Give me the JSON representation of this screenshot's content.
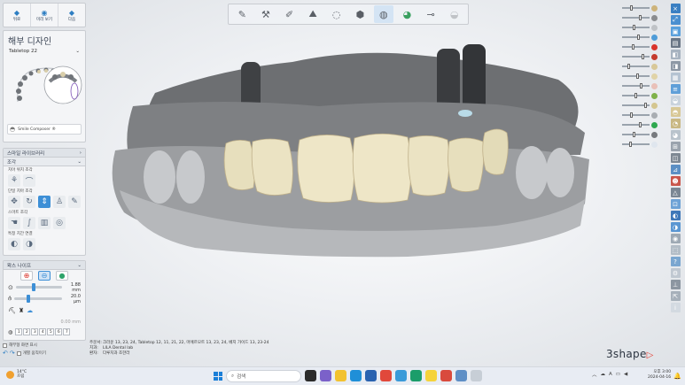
{
  "nav": {
    "back": "뒤로",
    "preview": "미리 보기",
    "next": "다음"
  },
  "design": {
    "title": "해부 디자인",
    "preset": "Tabletop 22"
  },
  "smile_composer": {
    "label": "Smile Composer ®"
  },
  "library": {
    "title": "스마일 라이브러리",
    "section": "조각",
    "sub1": "치아 위치 조각",
    "sub2": "단일 치아 조각",
    "sub3": "스마트 조각",
    "sub4": "특정 치간 연결"
  },
  "wax": {
    "title": "왁스 나이프",
    "size_value": "1.88 mm",
    "strength_value": "20.0 μm",
    "offset_value": "0.00 mm",
    "numbers": [
      "1",
      "2",
      "3",
      "4",
      "5",
      "6",
      "7"
    ],
    "size_fill": 0.35,
    "strength_fill": 0.25
  },
  "options": {
    "anatomy": "해부형 화면 표시",
    "separate": "개별 움직이기"
  },
  "info": {
    "order_label": "주문서:",
    "order_value": "크라운 13, 23, 24, Tabletop 12, 11, 21, 22, 마에르모트 13, 23, 24, 베지 가이드 13, 23-24",
    "clinic_label": "치과:",
    "clinic_value": "LILA Dental lab",
    "patient_label": "환자:",
    "patient_value": "다루치과 조한라"
  },
  "logo": {
    "text": "3shape",
    "mark": "▷"
  },
  "taskbar": {
    "temp": "14°C",
    "weather": "흐림",
    "search": "검색",
    "time": "오후 3:00",
    "date": "2024-04-16",
    "lang": "A"
  },
  "colors": {
    "accent": "#3d8fd6",
    "tooth": "#ece5c6",
    "stone": "#8a8c8f",
    "logo_mark": "#e43a2f"
  },
  "icons": {
    "top_toolbar": [
      "pencil-icon",
      "tools-icon",
      "brush-icon",
      "mound-icon",
      "tooth-outline-icon",
      "tooth-dark-icon",
      "tooth-active-icon",
      "tooth-green-icon",
      "probe-icon",
      "tooth-faded-icon"
    ]
  }
}
